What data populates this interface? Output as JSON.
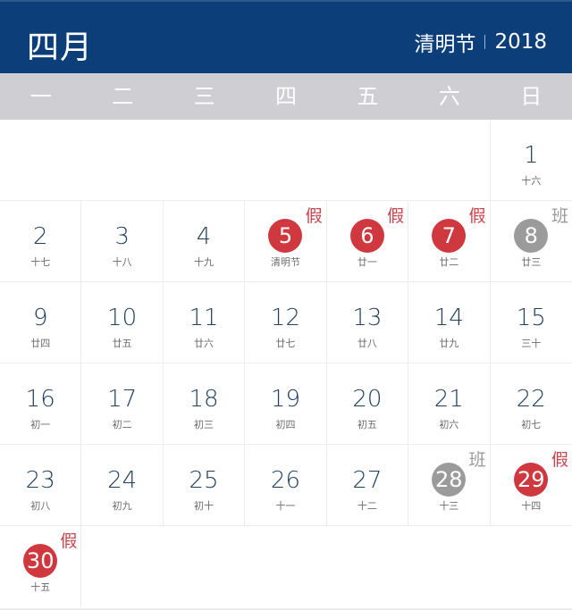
{
  "header": {
    "month": "四月",
    "festival": "清明节",
    "year": "2018",
    "background_color": "#0c3f7a"
  },
  "weekdays": [
    "一",
    "二",
    "三",
    "四",
    "五",
    "六",
    "日"
  ],
  "colors": {
    "holiday": "#d0383f",
    "workday": "#9b9b9b",
    "day_text": "#1f3f5e"
  },
  "legend": {
    "holiday_tag": "假",
    "workday_tag": "班"
  },
  "weeks": [
    [
      null,
      null,
      null,
      null,
      null,
      null,
      {
        "day": "1",
        "lunar": "十六",
        "type": "normal"
      }
    ],
    [
      {
        "day": "2",
        "lunar": "十七",
        "type": "normal"
      },
      {
        "day": "3",
        "lunar": "十八",
        "type": "normal"
      },
      {
        "day": "4",
        "lunar": "十九",
        "type": "normal"
      },
      {
        "day": "5",
        "lunar": "清明节",
        "type": "holiday",
        "tag": "假"
      },
      {
        "day": "6",
        "lunar": "廿一",
        "type": "holiday",
        "tag": "假"
      },
      {
        "day": "7",
        "lunar": "廿二",
        "type": "holiday",
        "tag": "假"
      },
      {
        "day": "8",
        "lunar": "廿三",
        "type": "work",
        "tag": "班"
      }
    ],
    [
      {
        "day": "9",
        "lunar": "廿四",
        "type": "normal"
      },
      {
        "day": "10",
        "lunar": "廿五",
        "type": "normal"
      },
      {
        "day": "11",
        "lunar": "廿六",
        "type": "normal"
      },
      {
        "day": "12",
        "lunar": "廿七",
        "type": "normal"
      },
      {
        "day": "13",
        "lunar": "廿八",
        "type": "normal"
      },
      {
        "day": "14",
        "lunar": "廿九",
        "type": "normal"
      },
      {
        "day": "15",
        "lunar": "三十",
        "type": "normal"
      }
    ],
    [
      {
        "day": "16",
        "lunar": "初一",
        "type": "normal"
      },
      {
        "day": "17",
        "lunar": "初二",
        "type": "normal"
      },
      {
        "day": "18",
        "lunar": "初三",
        "type": "normal"
      },
      {
        "day": "19",
        "lunar": "初四",
        "type": "normal"
      },
      {
        "day": "20",
        "lunar": "初五",
        "type": "normal"
      },
      {
        "day": "21",
        "lunar": "初六",
        "type": "normal"
      },
      {
        "day": "22",
        "lunar": "初七",
        "type": "normal"
      }
    ],
    [
      {
        "day": "23",
        "lunar": "初八",
        "type": "normal"
      },
      {
        "day": "24",
        "lunar": "初九",
        "type": "normal"
      },
      {
        "day": "25",
        "lunar": "初十",
        "type": "normal"
      },
      {
        "day": "26",
        "lunar": "十一",
        "type": "normal"
      },
      {
        "day": "27",
        "lunar": "十二",
        "type": "normal"
      },
      {
        "day": "28",
        "lunar": "十三",
        "type": "work",
        "tag": "班"
      },
      {
        "day": "29",
        "lunar": "十四",
        "type": "holiday",
        "tag": "假"
      }
    ],
    [
      {
        "day": "30",
        "lunar": "十五",
        "type": "holiday",
        "tag": "假"
      },
      null,
      null,
      null,
      null,
      null,
      null
    ]
  ]
}
